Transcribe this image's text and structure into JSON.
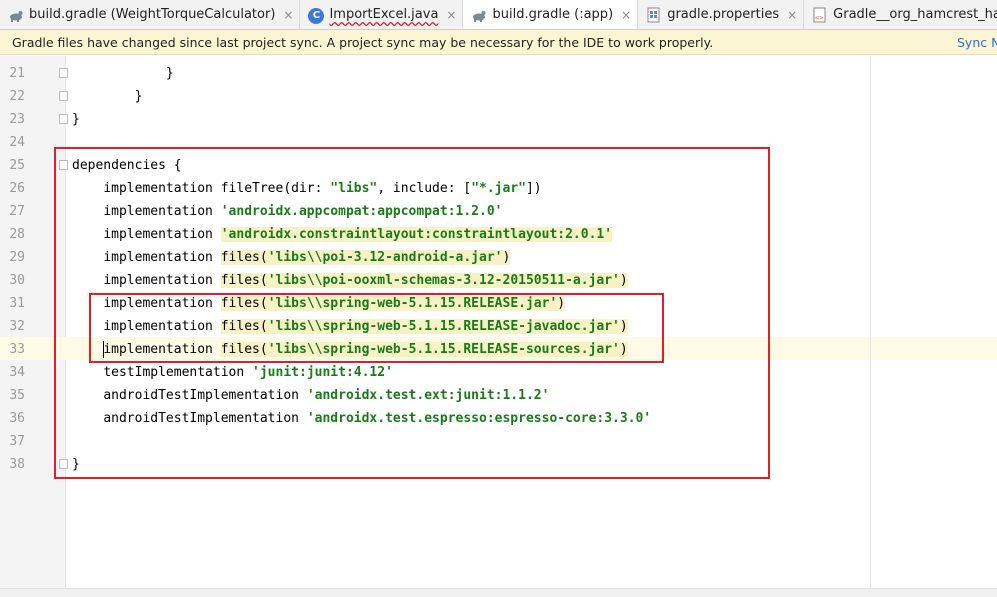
{
  "tabs": [
    {
      "icon": "gradle-icon",
      "label": "build.gradle (WeightTorqueCalculator)",
      "active": false
    },
    {
      "icon": "java-class-icon",
      "label": "ImportExcel.java",
      "active": false
    },
    {
      "icon": "gradle-icon",
      "label": "build.gradle (:app)",
      "active": true
    },
    {
      "icon": "properties-file-icon",
      "label": "gradle.properties",
      "active": false
    },
    {
      "icon": "library-xml-icon",
      "label": "Gradle__org_hamcrest_hamcrest_librar",
      "active": false
    }
  ],
  "notification": {
    "message": "Gradle files have changed since last project sync. A project sync may be necessary for the IDE to work properly.",
    "action": "Sync N"
  },
  "editor": {
    "partial_top": "",
    "lines": [
      {
        "n": "21",
        "indent": "            ",
        "parts": [
          [
            "}",
            ""
          ]
        ]
      },
      {
        "n": "22",
        "indent": "        ",
        "parts": [
          [
            "}",
            ""
          ]
        ]
      },
      {
        "n": "23",
        "indent": "",
        "parts": [
          [
            "}",
            ""
          ]
        ]
      },
      {
        "n": "24",
        "indent": "",
        "parts": []
      },
      {
        "n": "25",
        "indent": "",
        "parts": [
          [
            "dependencies {",
            ""
          ]
        ]
      },
      {
        "n": "26",
        "indent": "    ",
        "parts": [
          [
            "implementation fileTree(dir: ",
            ""
          ],
          [
            "\"libs\"",
            "str"
          ],
          [
            ", include: [",
            ""
          ],
          [
            "\"*.jar\"",
            "str"
          ],
          [
            "])",
            ""
          ]
        ]
      },
      {
        "n": "27",
        "indent": "    ",
        "parts": [
          [
            "implementation ",
            ""
          ],
          [
            "'androidx.appcompat:appcompat:1.2.0'",
            "str"
          ]
        ]
      },
      {
        "n": "28",
        "indent": "    ",
        "parts": [
          [
            "implementation ",
            ""
          ],
          [
            "'androidx.constraintlayout:constraintlayout:2.0.1'",
            "str hl"
          ]
        ]
      },
      {
        "n": "29",
        "indent": "    ",
        "parts": [
          [
            "implementation ",
            ""
          ],
          [
            "files(",
            "hl"
          ],
          [
            "'libs\\\\poi-3.12-android-a.jar'",
            "str hl"
          ],
          [
            ")",
            "hl"
          ]
        ]
      },
      {
        "n": "30",
        "indent": "    ",
        "parts": [
          [
            "implementation ",
            ""
          ],
          [
            "files(",
            "hl"
          ],
          [
            "'libs\\\\poi-ooxml-schemas-3.12-20150511-a.jar'",
            "str hl"
          ],
          [
            ")",
            "hl"
          ]
        ]
      },
      {
        "n": "31",
        "indent": "    ",
        "parts": [
          [
            "implementation ",
            ""
          ],
          [
            "files(",
            "hl"
          ],
          [
            "'libs\\\\spring-web-5.1.15.RELEASE.jar'",
            "str hl"
          ],
          [
            ")",
            "hl"
          ]
        ]
      },
      {
        "n": "32",
        "indent": "    ",
        "parts": [
          [
            "implementation ",
            ""
          ],
          [
            "files(",
            "hl"
          ],
          [
            "'libs\\\\spring-web-5.1.15.RELEASE-javadoc.jar'",
            "str hl"
          ],
          [
            ")",
            "hl"
          ]
        ]
      },
      {
        "n": "33",
        "indent": "    ",
        "parts": [
          [
            "implementation ",
            ""
          ],
          [
            "files(",
            "hl"
          ],
          [
            "'libs\\\\spring-web-5.1.15.RELEASE-sources.jar'",
            "str hl"
          ],
          [
            ")",
            "hl"
          ]
        ]
      },
      {
        "n": "34",
        "indent": "    ",
        "parts": [
          [
            "testImplementation ",
            ""
          ],
          [
            "'junit:junit:4.12'",
            "str"
          ]
        ]
      },
      {
        "n": "35",
        "indent": "    ",
        "parts": [
          [
            "androidTestImplementation ",
            ""
          ],
          [
            "'androidx.test.ext:junit:1.1.2'",
            "str"
          ]
        ]
      },
      {
        "n": "36",
        "indent": "    ",
        "parts": [
          [
            "androidTestImplementation ",
            ""
          ],
          [
            "'androidx.test.espresso:espresso-core:3.3.0'",
            "str"
          ]
        ]
      },
      {
        "n": "37",
        "indent": "",
        "parts": []
      },
      {
        "n": "38",
        "indent": "",
        "parts": [
          [
            "}",
            ""
          ]
        ]
      }
    ],
    "fold_markers": [
      "21",
      "22",
      "23",
      "25",
      "38"
    ],
    "current_line": "33"
  },
  "colors": {
    "string": "#1a7a1a",
    "annotation_box": "#e02028",
    "notification_bg": "#fbf5d4"
  }
}
